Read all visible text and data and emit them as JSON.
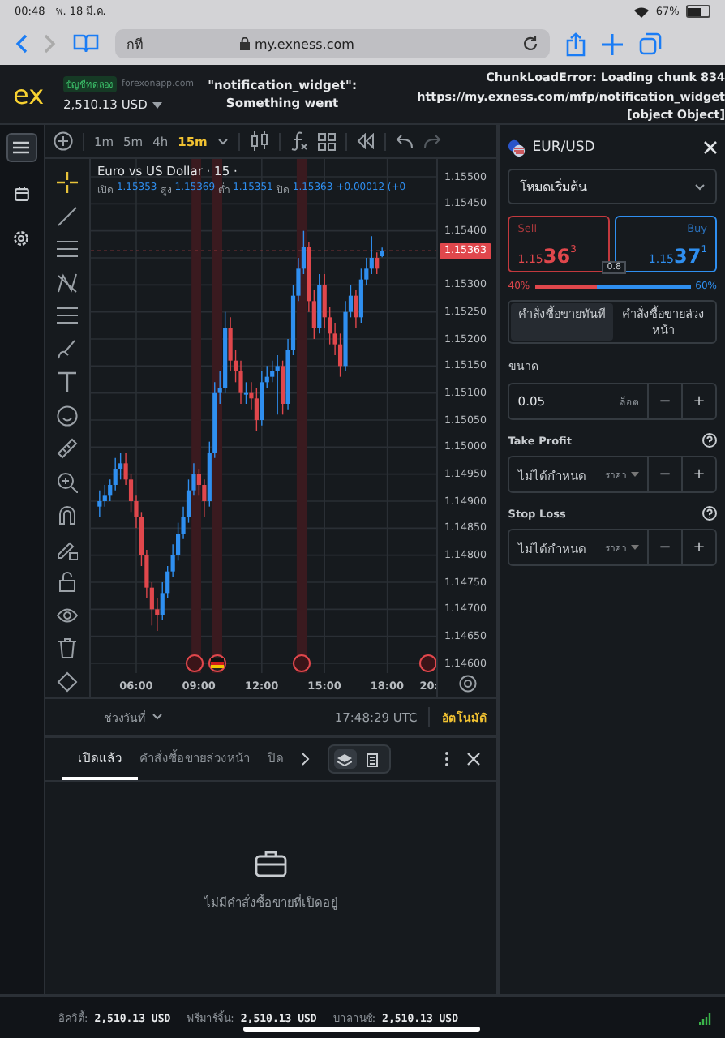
{
  "status_bar": {
    "time": "00:48",
    "date": "พ. 18 มี.ค.",
    "battery": "67%"
  },
  "browser": {
    "tab_text": "กที",
    "url": "my.exness.com"
  },
  "header": {
    "logo": "ex",
    "account_badge": "บัญชีทดลอง",
    "account_server": "forexonapp.com",
    "balance": "2,510.13 USD",
    "error_left": [
      "\"notification_widget\":",
      "Something went"
    ],
    "error_right": [
      "ChunkLoadError: Loading chunk 834",
      "https://my.exness.com/mfp/notification_widget",
      "[object Object]"
    ]
  },
  "sidebar": {
    "items": [
      {
        "kind": "list",
        "selected": true
      },
      {
        "kind": "calendar",
        "selected": false
      },
      {
        "kind": "settings",
        "selected": false
      }
    ]
  },
  "chart": {
    "timeframes": [
      {
        "label": "1m",
        "selected": false
      },
      {
        "label": "5m",
        "selected": false
      },
      {
        "label": "4h",
        "selected": false
      },
      {
        "label": "15m",
        "selected": true
      }
    ],
    "title": "Euro vs US Dollar · 15 ·",
    "ohlc": [
      {
        "label": "เปิด",
        "value": "1.15353"
      },
      {
        "label": "สูง",
        "value": "1.15369"
      },
      {
        "label": "ต่ำ",
        "value": "1.15351"
      },
      {
        "label": "ปิด",
        "value": "1.15363"
      }
    ],
    "change": "+0.00012 (+0",
    "current_price": "1.15363",
    "chart_data": {
      "type": "candlestick",
      "grid": true,
      "bands": [
        {
          "axis": "x",
          "from": 8.64,
          "to": 9.1
        },
        {
          "axis": "x",
          "from": 9.64,
          "to": 10.11
        },
        {
          "axis": "x",
          "from": 13.67,
          "to": 14.14
        }
      ],
      "ref_lines": [
        {
          "axis": "y",
          "value": 1.15363
        }
      ],
      "xlim": [
        3.83,
        20.34
      ],
      "ylim": [
        1.14582,
        1.15533
      ],
      "xticks": [
        {
          "value": 6,
          "label": "06:00"
        },
        {
          "value": 9,
          "label": "09:00"
        },
        {
          "value": 12,
          "label": "12:00"
        },
        {
          "value": 15,
          "label": "15:00"
        },
        {
          "value": 18,
          "label": "18:00"
        },
        {
          "value": 20,
          "label": "20:"
        }
      ],
      "yticks": [
        {
          "value": 1.155,
          "label": "1.15500"
        },
        {
          "value": 1.1545,
          "label": "1.15450"
        },
        {
          "value": 1.154,
          "label": "1.15400"
        },
        {
          "value": 1.153,
          "label": "1.15300"
        },
        {
          "value": 1.1525,
          "label": "1.15250"
        },
        {
          "value": 1.152,
          "label": "1.15200"
        },
        {
          "value": 1.1515,
          "label": "1.15150"
        },
        {
          "value": 1.151,
          "label": "1.15100"
        },
        {
          "value": 1.1505,
          "label": "1.15050"
        },
        {
          "value": 1.15,
          "label": "1.15000"
        },
        {
          "value": 1.1495,
          "label": "1.14950"
        },
        {
          "value": 1.149,
          "label": "1.14900"
        },
        {
          "value": 1.1485,
          "label": "1.14850"
        },
        {
          "value": 1.148,
          "label": "1.14800"
        },
        {
          "value": 1.1475,
          "label": "1.14750"
        },
        {
          "value": 1.147,
          "label": "1.14700"
        },
        {
          "value": 1.1465,
          "label": "1.14650"
        },
        {
          "value": 1.146,
          "label": "1.14600"
        }
      ],
      "x": [
        4.25,
        4.5,
        4.75,
        5,
        5.25,
        5.5,
        5.75,
        6,
        6.25,
        6.5,
        6.75,
        7,
        7.25,
        7.5,
        7.75,
        8,
        8.25,
        8.5,
        8.75,
        9,
        9.25,
        9.5,
        9.75,
        10,
        10.25,
        10.5,
        10.75,
        11,
        11.25,
        11.5,
        11.75,
        12,
        12.25,
        12.5,
        12.75,
        13,
        13.25,
        13.5,
        13.75,
        14,
        14.25,
        14.5,
        14.75,
        15,
        15.25,
        15.5,
        15.75,
        16,
        16.25,
        16.5,
        16.75,
        17,
        17.25,
        17.5,
        17.75
      ],
      "ohlc": [
        [
          1.1489,
          1.1492,
          1.1487,
          1.149
        ],
        [
          1.149,
          1.1493,
          1.1489,
          1.1491
        ],
        [
          1.1491,
          1.1494,
          1.149,
          1.1493
        ],
        [
          1.1493,
          1.1498,
          1.1492,
          1.1496
        ],
        [
          1.1496,
          1.1499,
          1.1494,
          1.1497
        ],
        [
          1.1497,
          1.1499,
          1.1493,
          1.1494
        ],
        [
          1.1494,
          1.1495,
          1.1488,
          1.149
        ],
        [
          1.149,
          1.1491,
          1.1485,
          1.1487
        ],
        [
          1.1487,
          1.1488,
          1.1478,
          1.148
        ],
        [
          1.148,
          1.1481,
          1.1472,
          1.1474
        ],
        [
          1.1474,
          1.1475,
          1.1467,
          1.147
        ],
        [
          1.147,
          1.1472,
          1.1466,
          1.1469
        ],
        [
          1.1469,
          1.1475,
          1.1468,
          1.1473
        ],
        [
          1.1473,
          1.1478,
          1.1472,
          1.1477
        ],
        [
          1.1477,
          1.1482,
          1.1476,
          1.148
        ],
        [
          1.148,
          1.1486,
          1.1479,
          1.1484
        ],
        [
          1.1484,
          1.1489,
          1.1483,
          1.1487
        ],
        [
          1.1487,
          1.1494,
          1.1486,
          1.1492
        ],
        [
          1.1492,
          1.1497,
          1.1491,
          1.1495
        ],
        [
          1.1495,
          1.1496,
          1.1491,
          1.1493
        ],
        [
          1.1493,
          1.1494,
          1.1487,
          1.149
        ],
        [
          1.149,
          1.1501,
          1.1489,
          1.1499
        ],
        [
          1.1499,
          1.1512,
          1.1498,
          1.151
        ],
        [
          1.151,
          1.1514,
          1.1508,
          1.1511
        ],
        [
          1.1511,
          1.1525,
          1.151,
          1.1522
        ],
        [
          1.1522,
          1.1524,
          1.1514,
          1.1516
        ],
        [
          1.1516,
          1.1518,
          1.1512,
          1.1514
        ],
        [
          1.1514,
          1.1516,
          1.1508,
          1.151
        ],
        [
          1.151,
          1.1512,
          1.1508,
          1.151
        ],
        [
          1.151,
          1.1512,
          1.1507,
          1.1509
        ],
        [
          1.1509,
          1.1511,
          1.1503,
          1.1505
        ],
        [
          1.1505,
          1.1514,
          1.1504,
          1.1512
        ],
        [
          1.1512,
          1.1515,
          1.1511,
          1.1513
        ],
        [
          1.1513,
          1.1516,
          1.1512,
          1.1514
        ],
        [
          1.1514,
          1.1517,
          1.1506,
          1.1515
        ],
        [
          1.1515,
          1.1516,
          1.1506,
          1.1508
        ],
        [
          1.1508,
          1.152,
          1.1507,
          1.1518
        ],
        [
          1.1518,
          1.153,
          1.1517,
          1.1528
        ],
        [
          1.1528,
          1.1535,
          1.1527,
          1.1533
        ],
        [
          1.1533,
          1.154,
          1.1532,
          1.1537
        ],
        [
          1.1537,
          1.1538,
          1.1525,
          1.1527
        ],
        [
          1.1527,
          1.1529,
          1.152,
          1.1522
        ],
        [
          1.1522,
          1.1532,
          1.1521,
          1.153
        ],
        [
          1.153,
          1.1532,
          1.1522,
          1.1524
        ],
        [
          1.1524,
          1.1526,
          1.1519,
          1.1521
        ],
        [
          1.1521,
          1.1523,
          1.1517,
          1.1519
        ],
        [
          1.1519,
          1.1521,
          1.1513,
          1.1515
        ],
        [
          1.1515,
          1.1527,
          1.1514,
          1.1525
        ],
        [
          1.1525,
          1.153,
          1.1524,
          1.1528
        ],
        [
          1.1528,
          1.1529,
          1.1522,
          1.1524
        ],
        [
          1.1524,
          1.1533,
          1.1523,
          1.1531
        ],
        [
          1.1531,
          1.1535,
          1.153,
          1.1533
        ],
        [
          1.1533,
          1.1539,
          1.1532,
          1.1535
        ],
        [
          1.1535,
          1.1536,
          1.1532,
          1.1533
        ],
        [
          1.15353,
          1.15369,
          1.15351,
          1.15363
        ]
      ]
    },
    "range_label": "ช่วงวันที่",
    "clock": "17:48:29 UTC",
    "autoscale": "อัตโนมัติ"
  },
  "order_panel": {
    "symbol": "EUR/USD",
    "mode": "โหมดเริ่มต้น",
    "sell": {
      "label": "Sell",
      "prefix": "1.15",
      "big": "36",
      "sup": "3"
    },
    "buy": {
      "label": "Buy",
      "prefix": "1.15",
      "big": "37",
      "sup": "1"
    },
    "spread": "0.8",
    "sell_pct": "40%",
    "buy_pct": "60%",
    "level": 0.4,
    "order_types": [
      {
        "label": "คำสั่งซื้อขายทันที",
        "selected": true
      },
      {
        "label": "คำสั่งซื้อขายล่วงหน้า",
        "selected": false
      }
    ],
    "volume": {
      "label": "ขนาด",
      "value": "0.05",
      "unit": "ล็อต",
      "minus": "−",
      "plus": "+"
    },
    "take_profit": {
      "label": "Take Profit",
      "value": "ไม่ได้กำหนด",
      "unit": "ราคา",
      "minus": "−",
      "plus": "+"
    },
    "stop_loss": {
      "label": "Stop Loss",
      "value": "ไม่ได้กำหนด",
      "unit": "ราคา",
      "minus": "−",
      "plus": "+"
    }
  },
  "positions": {
    "tabs": [
      {
        "label": "เปิดแล้ว",
        "selected": true
      },
      {
        "label": "คำสั่งซื้อขายล่วงหน้า",
        "selected": false
      },
      {
        "label": "ปิด",
        "selected": false
      }
    ],
    "view_modes": [
      {
        "kind": "stack",
        "selected": true
      },
      {
        "kind": "clipboard",
        "selected": false
      }
    ],
    "empty_text": "ไม่มีคำสั่งซื้อขายที่เปิดอยู่"
  },
  "footer": {
    "items": [
      {
        "label": "อิควิตี้:",
        "value": "2,510.13 USD"
      },
      {
        "label": "ฟรีมาร์จิ้น:",
        "value": "2,510.13 USD"
      },
      {
        "label": "บาลานซ์:",
        "value": "2,510.13 USD"
      }
    ]
  }
}
